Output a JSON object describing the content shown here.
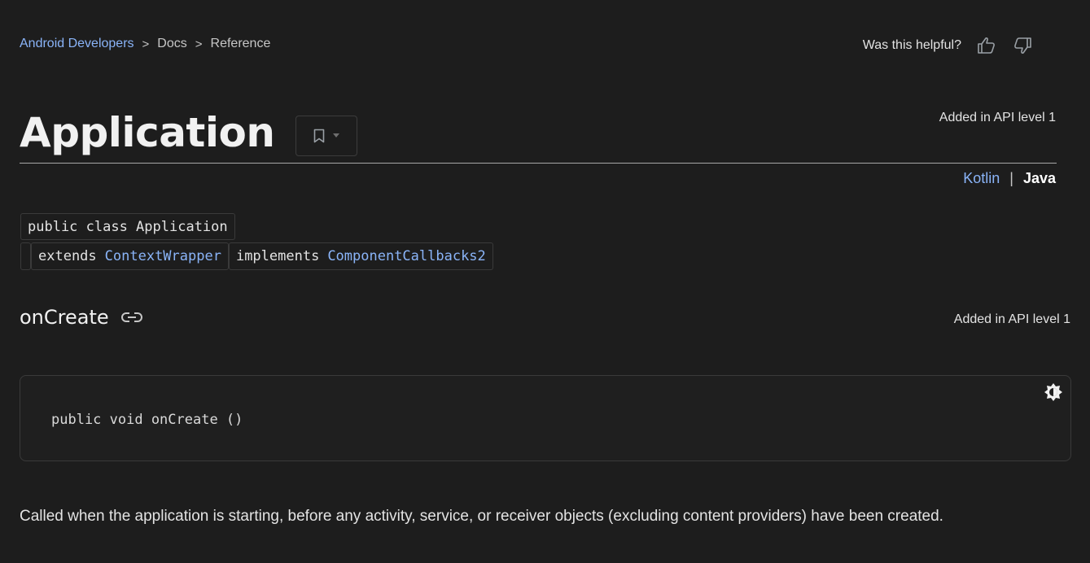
{
  "breadcrumb": {
    "root": "Android Developers",
    "items": [
      "Docs",
      "Reference"
    ],
    "separator": ">"
  },
  "feedback": {
    "prompt": "Was this helpful?",
    "thumbs_up_icon": "thumbs-up-icon",
    "thumbs_down_icon": "thumbs-down-icon"
  },
  "header": {
    "title": "Application",
    "bookmark_icon": "bookmark-icon",
    "api_level": "Added in API level 1"
  },
  "language": {
    "kotlin": "Kotlin",
    "separator": "|",
    "java": "Java",
    "selected": "Java"
  },
  "signature": {
    "declaration": "public class Application",
    "extends_keyword": "extends",
    "extends_class": "ContextWrapper",
    "implements_keyword": "implements",
    "implements_interface": "ComponentCallbacks2"
  },
  "method": {
    "name": "onCreate",
    "link_icon": "link-icon",
    "api_level": "Added in API level 1",
    "code": "public void onCreate ()",
    "theme_icon": "theme-toggle-icon",
    "description": "Called when the application is starting, before any activity, service, or receiver objects (excluding content providers) have been created."
  },
  "colors": {
    "background": "#1d1d1d",
    "link": "#8ab4f8",
    "text": "#e3e3e3"
  }
}
